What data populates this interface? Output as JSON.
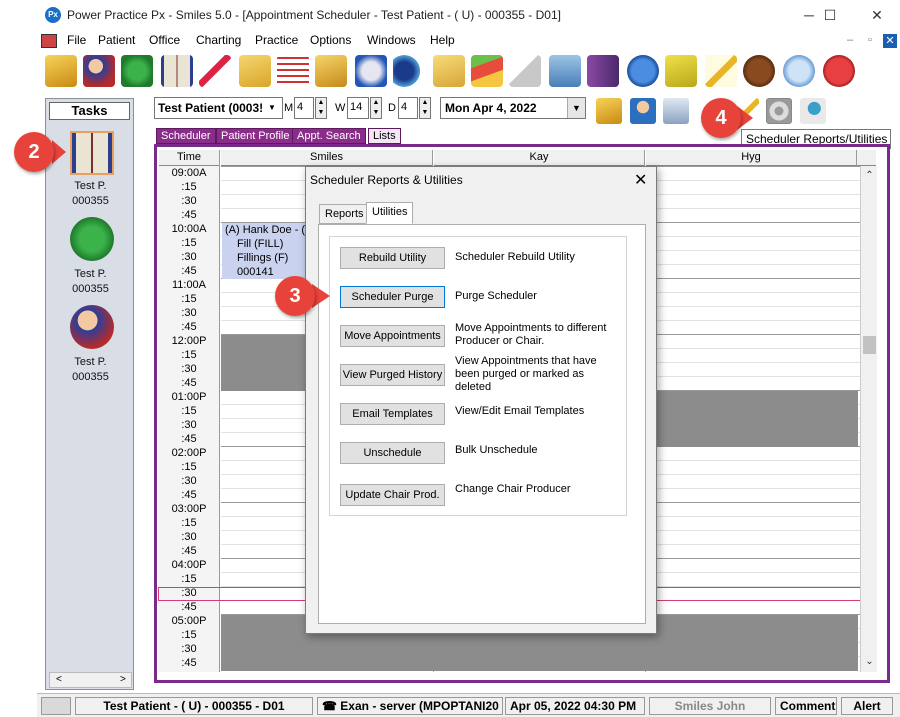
{
  "window": {
    "logo_text": "Px",
    "title": "Power Practice Px - Smiles 5.0 - [Appointment Scheduler - Test Patient - ( U) - 000355 - D01]",
    "minimize": "─",
    "maximize": "☐",
    "close": "✕"
  },
  "menu": {
    "items": [
      "File",
      "Patient",
      "Office",
      "Charting",
      "Practice",
      "Options",
      "Windows",
      "Help"
    ],
    "mdi_min": "–",
    "mdi_restore": "▫",
    "mdi_close": "✕"
  },
  "tasks": {
    "title": "Tasks",
    "items": [
      {
        "line1": "Test P.",
        "line2": "000355"
      },
      {
        "line1": "Test P.",
        "line2": "000355"
      },
      {
        "line1": "Test P.",
        "line2": "000355"
      }
    ],
    "scroll_left": "<",
    "scroll_right": ">"
  },
  "scheduler": {
    "patient": "Test Patient (0003!",
    "m_label": "M",
    "m_value": "4",
    "w_label": "W",
    "w_value": "14",
    "d_label": "D",
    "d_value": "4",
    "date": "Mon  Apr 4, 2022",
    "tooltip": "Scheduler Reports/Utilities",
    "tabs": [
      "Scheduler",
      "Patient Profile",
      "Appt. Search",
      "Lists"
    ],
    "columns": [
      "Time",
      "Smiles",
      "Kay",
      "Hyg"
    ],
    "times": [
      "09:00A",
      ":15",
      ":30",
      ":45",
      "10:00A",
      ":15",
      ":30",
      ":45",
      "11:00A",
      ":15",
      ":30",
      ":45",
      "12:00P",
      ":15",
      ":30",
      ":45",
      "01:00P",
      ":15",
      ":30",
      ":45",
      "02:00P",
      ":15",
      ":30",
      ":45",
      "03:00P",
      ":15",
      ":30",
      ":45",
      "04:00P",
      ":15",
      ":30",
      ":45",
      "05:00P",
      ":15",
      ":30",
      ":45"
    ],
    "appointment": {
      "line1": "(A) Hank Doe - (D",
      "line2": "Fill (FILL)",
      "line3": "Fillings (F)",
      "line4": "000141"
    }
  },
  "badges": [
    "2",
    "3",
    "4"
  ],
  "dialog": {
    "title": "Scheduler Reports & Utilities",
    "close": "✕",
    "tabs": [
      "Reports",
      "Utilities"
    ],
    "utilities": [
      {
        "button": "Rebuild Utility",
        "desc": "Scheduler Rebuild Utility"
      },
      {
        "button": "Scheduler Purge",
        "desc": "Purge Scheduler"
      },
      {
        "button": "Move Appointments",
        "desc": "Move Appointments to different Producer or Chair."
      },
      {
        "button": "View Purged History",
        "desc": "View Appointments that have been purged or marked as deleted"
      },
      {
        "button": "Email Templates",
        "desc": "View/Edit Email Templates"
      },
      {
        "button": "Unschedule",
        "desc": "Bulk Unschedule"
      },
      {
        "button": "Update Chair Prod.",
        "desc": "Change Chair Producer"
      }
    ]
  },
  "status": {
    "patient": "Test Patient - ( U) - 000355 - D01",
    "exam": "Exan - server (MPOPTANI20",
    "datetime": "Apr 05, 2022 04:30 PM",
    "user": "Smiles John",
    "comment": "Comment",
    "alert": "Alert"
  },
  "colors": {
    "accent_purple": "#8a2d8a",
    "badge_red": "#e8433a",
    "appointment_blue": "#c9d2ee",
    "blocked_gray": "#8c8c8c"
  }
}
